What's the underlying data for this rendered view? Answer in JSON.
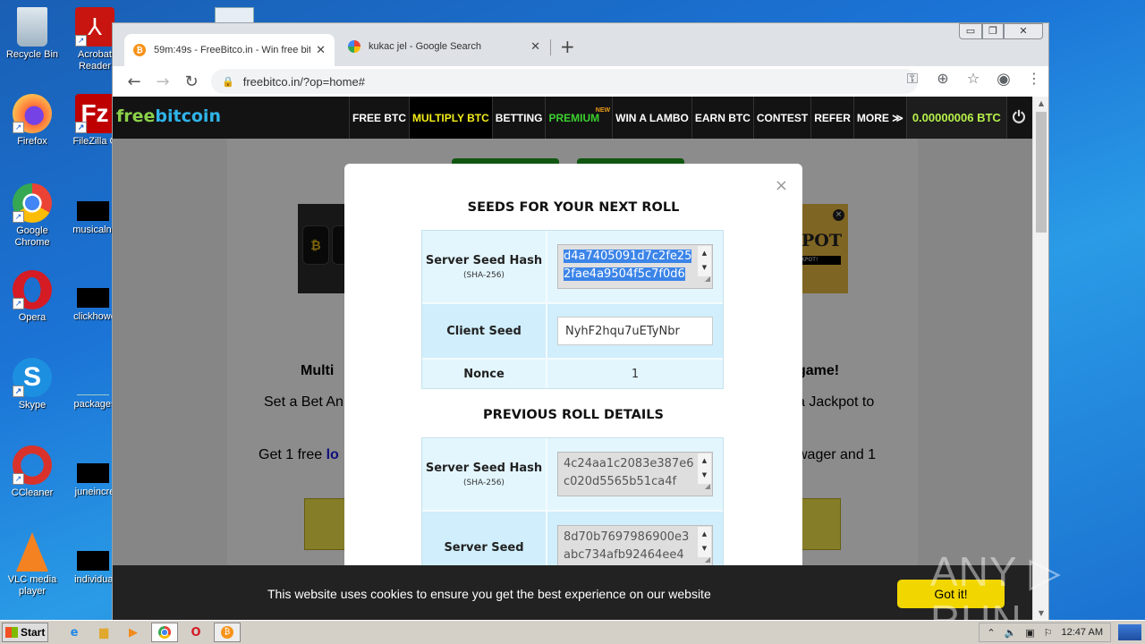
{
  "desktop": {
    "icons_col1": [
      {
        "label": "Recycle Bin",
        "icon": "recycle-bin-icon"
      },
      {
        "label": "Firefox",
        "icon": "firefox-icon"
      },
      {
        "label": "Google Chrome",
        "icon": "chrome-icon"
      },
      {
        "label": "Opera",
        "icon": "opera-icon"
      },
      {
        "label": "Skype",
        "icon": "skype-icon"
      },
      {
        "label": "CCleaner",
        "icon": "ccleaner-icon"
      },
      {
        "label": "VLC media player",
        "icon": "vlc-icon"
      }
    ],
    "icons_col2": [
      {
        "label": "Acrobat Reader",
        "icon": "acrobat-icon"
      },
      {
        "label": "FileZilla C",
        "icon": "filezilla-icon"
      },
      {
        "label": "musicalne",
        "icon": "redacted-file-icon"
      },
      {
        "label": "clickhowe",
        "icon": "redacted-file-icon"
      },
      {
        "label": "packages",
        "icon": "file-icon"
      },
      {
        "label": "juneincre",
        "icon": "redacted-file-icon"
      },
      {
        "label": "individual",
        "icon": "redacted-file-icon"
      }
    ]
  },
  "browser": {
    "tabs": [
      {
        "title": "59m:49s - FreeBitco.in - Win free bit",
        "favicon": "bitcoin-icon",
        "active": true
      },
      {
        "title": "kukac jel - Google Search",
        "favicon": "google-icon",
        "active": false
      }
    ],
    "new_tab": "+",
    "close_glyph": "✕",
    "url": "freebitco.in/?op=home#",
    "window_controls": {
      "minimize": "▭",
      "maximize": "❐",
      "close": "✕"
    }
  },
  "site": {
    "logo": {
      "part1": "free",
      "part2": "bitcoin"
    },
    "nav": [
      {
        "label": "FREE BTC",
        "style": "white"
      },
      {
        "label": "MULTIPLY BTC",
        "style": "yellow"
      },
      {
        "label": "BETTING",
        "style": "white"
      },
      {
        "label": "PREMIUM",
        "style": "green",
        "badge": "NEW"
      },
      {
        "label": "WIN A LAMBO",
        "style": "white"
      },
      {
        "label": "EARN BTC",
        "style": "white"
      },
      {
        "label": "CONTEST",
        "style": "white"
      },
      {
        "label": "REFER",
        "style": "white"
      },
      {
        "label": "MORE ≫",
        "style": "white"
      }
    ],
    "balance": "0.00000006 BTC",
    "power_glyph": "⏻",
    "ad_right": {
      "title": "POT",
      "subtitle": "KPOT!"
    },
    "body_texts": {
      "heading_left": "Multi",
      "heading_right": "game!",
      "line1_left": "Set a Bet An",
      "line1_right": "a Jackpot to",
      "line2_left": "Get 1 free ",
      "line2_link": "lo",
      "line2_right": "wager and 1"
    }
  },
  "modal": {
    "close": "×",
    "next_roll": {
      "title": "SEEDS FOR YOUR NEXT ROLL",
      "server_seed_hash_label": "Server Seed Hash",
      "server_seed_hash_sub": "(SHA-256)",
      "server_seed_hash_value": "d4a7405091d7c2fe252fae4a9504f5c7f0d6",
      "client_seed_label": "Client Seed",
      "client_seed_value": "NyhF2hqu7uETyNbr",
      "nonce_label": "Nonce",
      "nonce_value": "1"
    },
    "previous_roll": {
      "title": "PREVIOUS ROLL DETAILS",
      "server_seed_hash_label": "Server Seed Hash",
      "server_seed_hash_sub": "(SHA-256)",
      "server_seed_hash_value": "4c24aa1c2083e387e6c020d5565b51ca4f",
      "server_seed_label": "Server Seed",
      "server_seed_value": "8d70b7697986900e3abc734afb92464ee4"
    }
  },
  "cookie_bar": {
    "message": "This website uses cookies to ensure you get the best experience on our website",
    "button": "Got it!"
  },
  "watermark": "ANY ▷ RUN",
  "taskbar": {
    "start": "Start",
    "apps": [
      "ie-icon",
      "explorer-icon",
      "media-player-icon",
      "chrome-icon",
      "opera-icon",
      "bitcoin-icon"
    ],
    "clock": "12:47 AM"
  }
}
